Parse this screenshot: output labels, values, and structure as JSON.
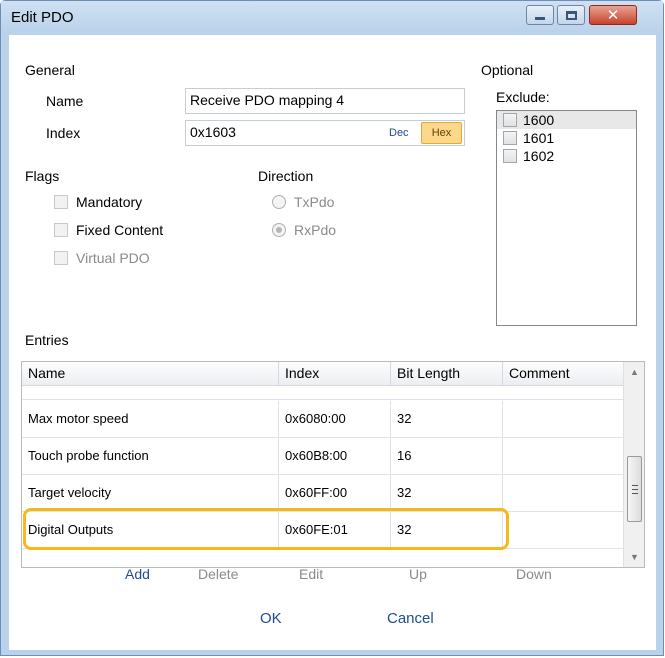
{
  "window": {
    "title": "Edit PDO"
  },
  "general": {
    "section_label": "General",
    "name_label": "Name",
    "name_value": "Receive PDO mapping 4",
    "index_label": "Index",
    "index_value": "0x1603",
    "dec_label": "Dec",
    "hex_label": "Hex"
  },
  "optional": {
    "section_label": "Optional",
    "exclude_label": "Exclude:",
    "items": [
      "1600",
      "1601",
      "1602"
    ]
  },
  "flags": {
    "section_label": "Flags",
    "mandatory": "Mandatory",
    "fixed_content": "Fixed Content",
    "virtual_pdo": "Virtual PDO"
  },
  "direction": {
    "section_label": "Direction",
    "txpdo": "TxPdo",
    "rxpdo": "RxPdo",
    "selected": "RxPdo"
  },
  "entries": {
    "section_label": "Entries",
    "columns": [
      "Name",
      "Index",
      "Bit Length",
      "Comment"
    ],
    "rows": [
      {
        "name": "Max motor speed",
        "index": "0x6080:00",
        "bit_length": "32",
        "comment": ""
      },
      {
        "name": "Touch probe function",
        "index": "0x60B8:00",
        "bit_length": "16",
        "comment": ""
      },
      {
        "name": "Target velocity",
        "index": "0x60FF:00",
        "bit_length": "32",
        "comment": ""
      },
      {
        "name": "Digital Outputs",
        "index": "0x60FE:01",
        "bit_length": "32",
        "comment": ""
      }
    ],
    "highlighted_row": "Digital Outputs"
  },
  "actions": {
    "add": "Add",
    "delete": "Delete",
    "edit": "Edit",
    "up": "Up",
    "down": "Down"
  },
  "buttons": {
    "ok": "OK",
    "cancel": "Cancel"
  },
  "colors": {
    "highlight": "#f6b81a",
    "link": "#1f4d8f",
    "hex_active": "#fcd88a"
  }
}
